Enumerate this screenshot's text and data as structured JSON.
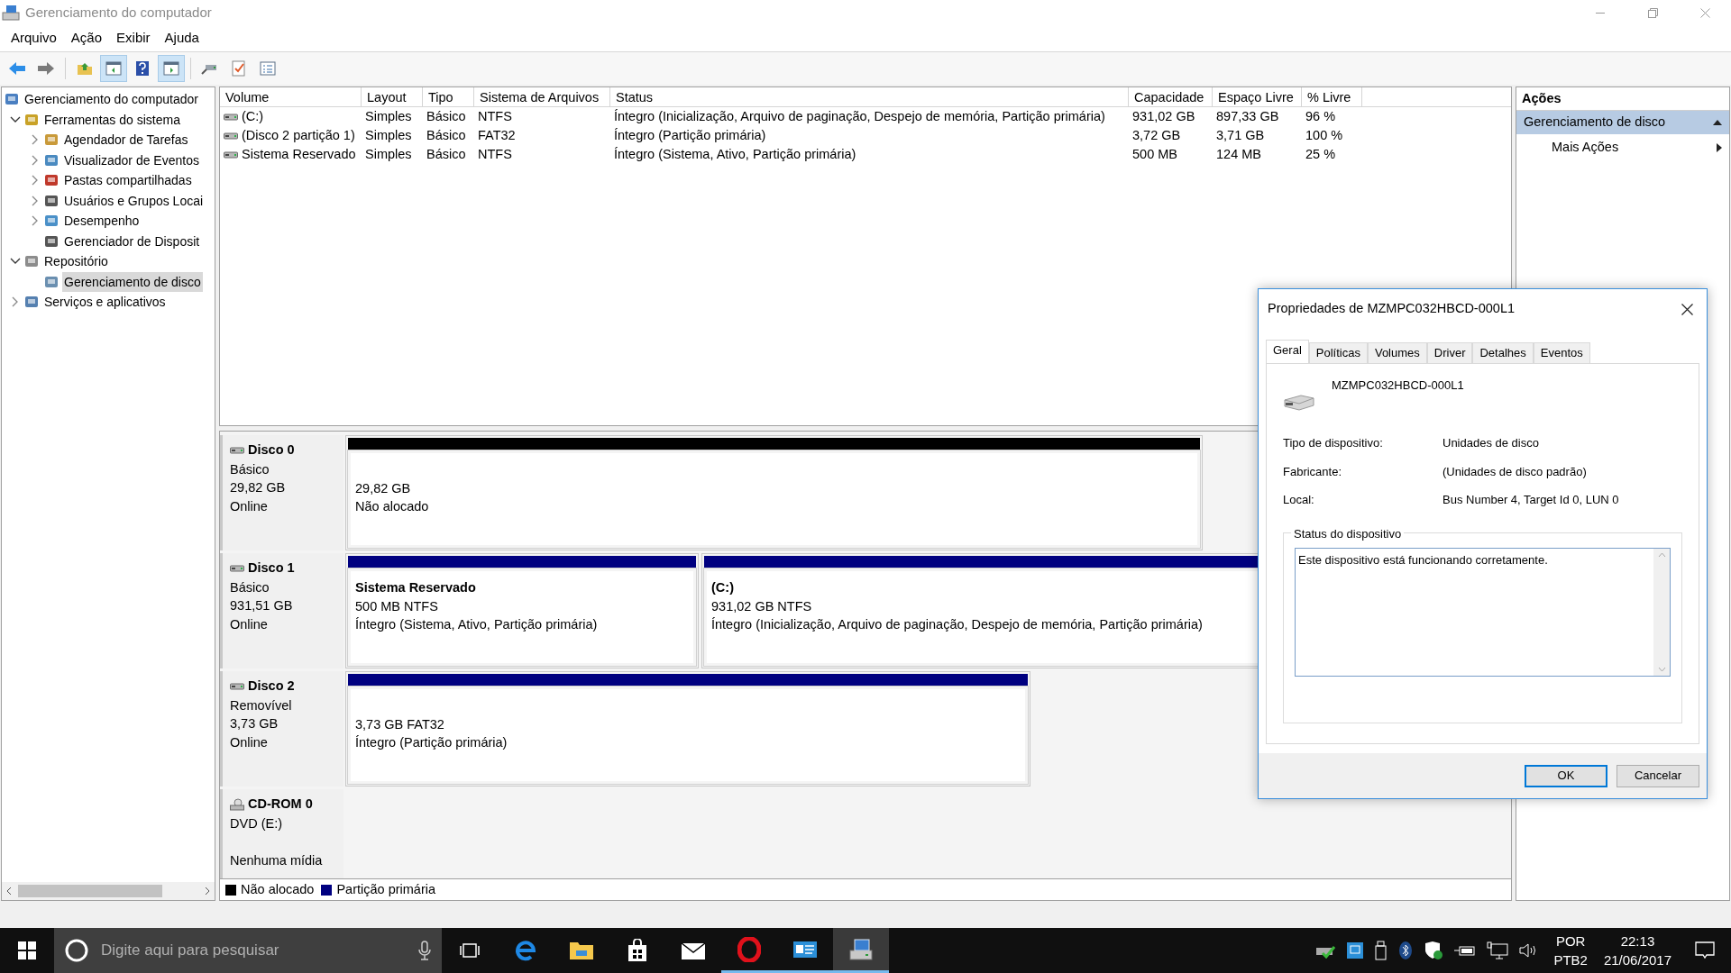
{
  "window": {
    "title": "Gerenciamento do computador"
  },
  "menu": [
    "Arquivo",
    "Ação",
    "Exibir",
    "Ajuda"
  ],
  "toolbar": [
    {
      "kind": "back",
      "pressed": false
    },
    {
      "kind": "forward",
      "pressed": false
    },
    {
      "kind": "up-folder",
      "pressed": false
    },
    {
      "kind": "tree-pane",
      "pressed": true
    },
    {
      "kind": "help",
      "pressed": false
    },
    {
      "kind": "action-pane",
      "pressed": true
    },
    {
      "kind": "connect",
      "pressed": false
    },
    {
      "kind": "checklist",
      "pressed": false
    },
    {
      "kind": "list",
      "pressed": false
    }
  ],
  "tree": [
    {
      "label": "Gerenciamento do computador",
      "selected": false,
      "children": [
        {
          "label": "Ferramentas do sistema",
          "selected": false,
          "expanded": true,
          "children": [
            {
              "label": "Agendador de Tarefas",
              "selected": false,
              "expanded": false
            },
            {
              "label": "Visualizador de Eventos",
              "selected": false,
              "expanded": false
            },
            {
              "label": "Pastas compartilhadas",
              "selected": false,
              "expanded": false
            },
            {
              "label": "Usuários e Grupos Locai",
              "selected": false,
              "expanded": false
            },
            {
              "label": "Desempenho",
              "selected": false,
              "expanded": false
            },
            {
              "label": "Gerenciador de Disposit",
              "selected": false
            }
          ]
        },
        {
          "label": "Repositório",
          "selected": false,
          "expanded": true,
          "children": [
            {
              "label": "Gerenciamento de disco",
              "selected": true
            }
          ]
        },
        {
          "label": "Serviços e aplicativos",
          "selected": false,
          "expanded": false
        }
      ]
    }
  ],
  "table": {
    "columns": [
      "Volume",
      "Layout",
      "Tipo",
      "Sistema de Arquivos",
      "Status",
      "Capacidade",
      "Espaço Livre",
      "% Livre"
    ],
    "rows": [
      {
        "cells": [
          "(C:)",
          "Simples",
          "Básico",
          "NTFS",
          "Íntegro (Inicialização, Arquivo de paginação, Despejo de memória, Partição primária)",
          "931,02 GB",
          "897,33 GB",
          "96 %"
        ]
      },
      {
        "cells": [
          "(Disco 2 partição 1)",
          "Simples",
          "Básico",
          "FAT32",
          "Íntegro (Partição primária)",
          "3,72 GB",
          "3,71 GB",
          "100 %"
        ]
      },
      {
        "cells": [
          "Sistema Reservado",
          "Simples",
          "Básico",
          "NTFS",
          "Íntegro (Sistema, Ativo, Partição primária)",
          "500 MB",
          "124 MB",
          "25 %"
        ]
      }
    ]
  },
  "disks": [
    {
      "kind": "disk",
      "name": "Disco 0",
      "lines": [
        "Básico",
        "29,82 GB",
        "Online"
      ],
      "partitions": [
        {
          "kind": "unallocated",
          "lines": [
            "29,82 GB",
            "Não alocado"
          ]
        }
      ]
    },
    {
      "kind": "disk",
      "name": "Disco 1",
      "lines": [
        "Básico",
        "931,51 GB",
        "Online"
      ],
      "partitions": [
        {
          "kind": "primary",
          "title": "Sistema Reservado",
          "lines": [
            "500 MB NTFS",
            "Íntegro (Sistema, Ativo, Partição primária)"
          ]
        },
        {
          "kind": "primary",
          "title": "(C:)",
          "lines": [
            "931,02 GB NTFS",
            "Íntegro (Inicialização, Arquivo de paginação, Despejo de memória, Partição primária)"
          ]
        }
      ]
    },
    {
      "kind": "disk",
      "name": "Disco 2",
      "lines": [
        "Removível",
        "3,73 GB",
        "Online"
      ],
      "partitions": [
        {
          "kind": "primary",
          "lines": [
            "3,73 GB FAT32",
            "Íntegro (Partição primária)"
          ]
        }
      ]
    },
    {
      "kind": "cdrom",
      "name": "CD-ROM 0",
      "lines": [
        "DVD (E:)",
        "Nenhuma mídia"
      ]
    }
  ],
  "legend": [
    {
      "label": "Não alocado",
      "color": "#000000"
    },
    {
      "label": "Partição primária",
      "color": "#000080"
    }
  ],
  "actions": {
    "title": "Ações",
    "section": "Gerenciamento de disco",
    "items": [
      "Mais Ações"
    ]
  },
  "dialog": {
    "title": "Propriedades de MZMPC032HBCD-000L1",
    "tabs": [
      {
        "label": "Geral",
        "selected": true
      },
      {
        "label": "Políticas",
        "selected": false
      },
      {
        "label": "Volumes",
        "selected": false
      },
      {
        "label": "Driver",
        "selected": false
      },
      {
        "label": "Detalhes",
        "selected": false
      },
      {
        "label": "Eventos",
        "selected": false
      }
    ],
    "device_name": "MZMPC032HBCD-000L1",
    "properties": [
      {
        "label": "Tipo de dispositivo:",
        "value": "Unidades de disco"
      },
      {
        "label": "Fabricante:",
        "value": "(Unidades de disco padrão)"
      },
      {
        "label": "Local:",
        "value": "Bus Number 4, Target Id 0, LUN 0"
      }
    ],
    "status_group": "Status do dispositivo",
    "status_text": "Este dispositivo está funcionando corretamente.",
    "buttons": [
      {
        "label": "OK",
        "default": true
      },
      {
        "label": "Cancelar",
        "default": false
      }
    ]
  },
  "taskbar": {
    "search_placeholder": "Digite aqui para pesquisar",
    "apps": [
      {
        "kind": "task-view",
        "running": false,
        "active": false
      },
      {
        "kind": "e-logo",
        "running": false,
        "active": false
      },
      {
        "kind": "folder",
        "running": false,
        "active": false
      },
      {
        "kind": "bag",
        "running": false,
        "active": false
      },
      {
        "kind": "mail",
        "running": false,
        "active": false
      },
      {
        "kind": "o-logo",
        "running": true,
        "active": false
      },
      {
        "kind": "card",
        "running": true,
        "active": false
      },
      {
        "kind": "computer",
        "running": true,
        "active": true
      }
    ],
    "language": "POR",
    "layout": "PTB2",
    "time": "22:13",
    "date": "21/06/2017"
  }
}
